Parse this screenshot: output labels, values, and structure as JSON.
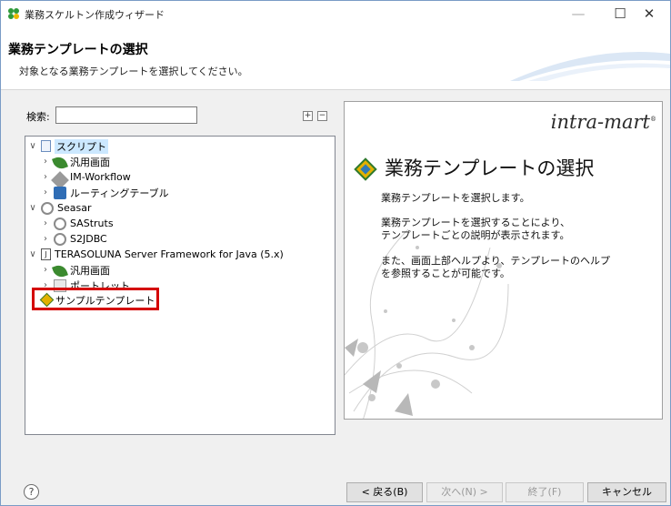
{
  "window": {
    "title": "業務スケルトン作成ウィザード",
    "min_glyph": "—",
    "max_glyph": "☐",
    "close_glyph": "✕"
  },
  "header": {
    "title": "業務テンプレートの選択",
    "subtitle": "対象となる業務テンプレートを選択してください。"
  },
  "search": {
    "label": "検索:",
    "value": "",
    "placeholder": ""
  },
  "toolbar": {
    "expand_glyph": "+",
    "collapse_glyph": "−"
  },
  "tree": [
    {
      "label": "スクリプト",
      "expanded": true,
      "selected": true,
      "icon": "script-icon"
    },
    {
      "label": "汎用画面",
      "icon": "leaf-icon"
    },
    {
      "label": "IM-Workflow",
      "icon": "pen-icon"
    },
    {
      "label": "ルーティングテーブル",
      "icon": "routing-icon"
    },
    {
      "label": "Seasar",
      "expanded": true,
      "icon": "seasar-icon"
    },
    {
      "label": "SAStruts",
      "icon": "seasar-icon"
    },
    {
      "label": "S2JDBC",
      "icon": "seasar-icon"
    },
    {
      "label": "TERASOLUNA Server Framework for Java (5.x)",
      "expanded": true,
      "icon": "jar-icon"
    },
    {
      "label": "汎用画面",
      "icon": "leaf-icon"
    },
    {
      "label": "ポートレット",
      "icon": "portlet-icon"
    },
    {
      "label": "サンプルテンプレート",
      "icon": "template-icon"
    }
  ],
  "twisty": {
    "expanded": "∨",
    "collapsed": "›"
  },
  "description": {
    "logo": "intra-mart",
    "logo_mark": "®",
    "title": "業務テンプレートの選択",
    "line1": "業務テンプレートを選択します。",
    "line2a": "業務テンプレートを選択することにより、",
    "line2b": "テンプレートごとの説明が表示されます。",
    "line3a": "また、画面上部ヘルプより、テンプレートのヘルプ",
    "line3b": "を参照することが可能です。"
  },
  "buttons": {
    "help": "?",
    "back": "< 戻る(B)",
    "next": "次へ(N) >",
    "finish": "終了(F)",
    "cancel": "キャンセル"
  },
  "colors": {
    "highlight": "#d40000",
    "selection": "#cce8ff"
  }
}
